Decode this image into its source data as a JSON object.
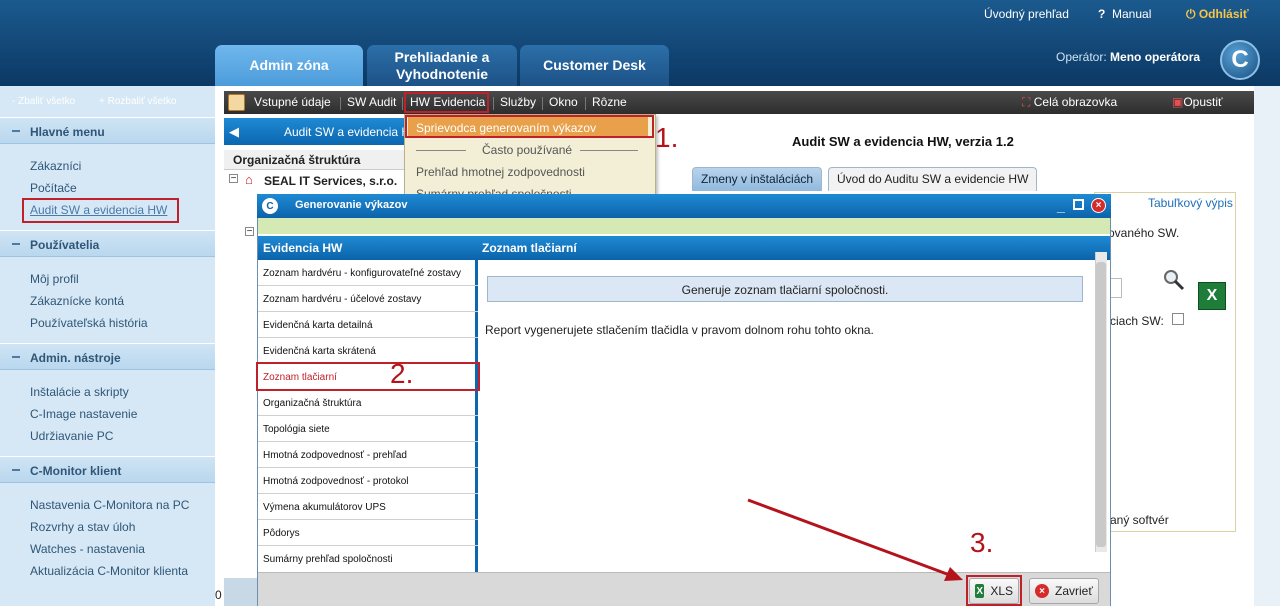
{
  "header": {
    "links": {
      "intro": "Úvodný prehľad",
      "manual": "Manual",
      "logout": "Odhlásiť"
    },
    "tabs": [
      "Admin zóna",
      "Prehliadanie a\nVyhodnotenie",
      "Customer Desk"
    ],
    "operator_label": "Operátor:",
    "operator_name": "Meno operátora",
    "logo_letter": "C"
  },
  "sidebar": {
    "collapse_all": "- Zbaliť všetko",
    "expand_all": "+ Rozbaliť všetko",
    "sections": [
      {
        "title": "Hlavné menu",
        "items": [
          "Zákazníci",
          "Počítače",
          "Audit SW a evidencia HW"
        ]
      },
      {
        "title": "Používatelia",
        "items": [
          "Môj profil",
          "Zákaznícke kontá",
          "Používateľská história"
        ]
      },
      {
        "title": "Admin. nástroje",
        "items": [
          "Inštalácie a skripty",
          "C-Image nastavenie",
          "Udržiavanie PC"
        ]
      },
      {
        "title": "C-Monitor klient",
        "items": [
          "Nastavenia C-Monitora na PC",
          "Rozvrhy a stav úloh",
          "Watches - nastavenia",
          "Aktualizácia C-Monitor klienta"
        ]
      }
    ]
  },
  "toolbar": {
    "items": [
      "Vstupné údaje",
      "SW Audit",
      "HW Evidencia",
      "Služby",
      "Okno",
      "Rôzne"
    ],
    "fullscreen": "Celá obrazovka",
    "exit": "Opustiť"
  },
  "panel": {
    "breadcrumb": "Audit SW a evidencia H",
    "title": "Audit SW a evidencia HW, verzia 1.2",
    "org_label": "Organizačná štruktúra",
    "company": "SEAL IT Services, s.r.o.",
    "tabs": [
      "Zmeny v inštaláciách",
      "Úvod do Auditu SW a evidencie HW"
    ],
    "right_link": "Tabuľkový výpis",
    "right_text1": "ovaného SW.",
    "right_text2": "ciach SW:",
    "right_text3": "aný softvér",
    "left_number": "0"
  },
  "dropdown": {
    "item_selected": "Sprievodca generovaním výkazov",
    "section_label": "Často používané",
    "items": [
      "Prehľad hmotnej zodpovednosti",
      "Sumárny prehľad spoločnosti"
    ]
  },
  "modal": {
    "title": "Generovanie výkazov",
    "left_header": "Evidencia HW",
    "right_header": "Zoznam tlačiarní",
    "list": [
      "Zoznam hardvéru - konfigurovateľné zostavy",
      "Zoznam hardvéru - účelové zostavy",
      "Evidenčná karta detailná",
      "Evidenčná karta skrátená",
      "Zoznam tlačiarní",
      "Organizačná štruktúra",
      "Topológia siete",
      "Hmotná zodpovednosť - prehľad",
      "Hmotná zodpovednosť - protokol",
      "Výmena akumulátorov UPS",
      "Pôdorys",
      "Sumárny prehľad spoločnosti"
    ],
    "generate_box": "Generuje zoznam tlačiarní spoločnosti.",
    "description": "Report vygenerujete stlačením tlačidla v pravom dolnom rohu tohto okna.",
    "xls_button": "XLS",
    "close_button": "Zavrieť"
  },
  "annotations": {
    "step1": "1.",
    "step2": "2.",
    "step3": "3."
  },
  "colors": {
    "accent": "#0b67b0",
    "highlight": "#c0202a",
    "header": "#0c3864"
  }
}
